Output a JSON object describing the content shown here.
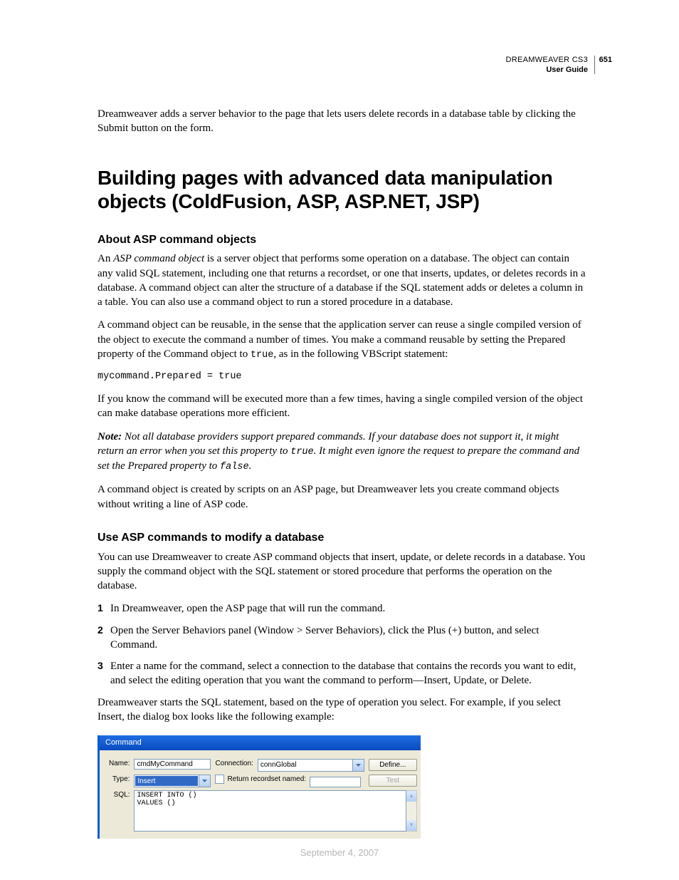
{
  "header": {
    "product": "DREAMWEAVER CS3",
    "guide": "User Guide",
    "page_number": "651"
  },
  "intro_paragraph": "Dreamweaver adds a server behavior to the page that lets users delete records in a database table by clicking the Submit button on the form.",
  "h1": "Building pages with advanced data manipulation objects (ColdFusion, ASP, ASP.NET, JSP)",
  "section1": {
    "heading": "About ASP command objects",
    "p1_lead_in": "An ",
    "p1_em": "ASP command object",
    "p1_rest": " is a server object that performs some operation on a database. The object can contain any valid SQL statement, including one that returns a recordset, or one that inserts, updates, or deletes records in a database. A command object can alter the structure of a database if the SQL statement adds or deletes a column in a table. You can also use a command object to run a stored procedure in a database.",
    "p2_a": "A command object can be reusable, in the sense that the application server can reuse a single compiled version of the object to execute the command a number of times. You make a command reusable by setting the Prepared property of the Command object to ",
    "p2_code": "true",
    "p2_b": ", as in the following VBScript statement:",
    "code_block": "mycommand.Prepared = true",
    "p3": "If you know the command will be executed more than a few times, having a single compiled version of the object can make database operations more efficient.",
    "note_label": "Note:",
    "note_a": " Not all database providers support prepared commands. If your database does not support it, it might return an error when you set this property to ",
    "note_code1": "true",
    "note_b": ". It might even ignore the request to prepare the command and set the Prepared property to ",
    "note_code2": "false",
    "note_c": ".",
    "p4": "A command object is created by scripts on an ASP page, but Dreamweaver lets you create command objects without writing a line of ASP code."
  },
  "section2": {
    "heading": "Use ASP commands to modify a database",
    "p1": "You can use Dreamweaver to create ASP command objects that insert, update, or delete records in a database. You supply the command object with the SQL statement or stored procedure that performs the operation on the database.",
    "steps": [
      "In Dreamweaver, open the ASP page that will run the command.",
      "Open the Server Behaviors panel (Window > Server Behaviors), click the Plus (+) button, and select Command.",
      "Enter a name for the command, select a connection to the database that contains the records you want to edit, and select the editing operation that you want the command to perform—Insert, Update, or Delete."
    ],
    "p2": "Dreamweaver starts the SQL statement, based on the type of operation you select. For example, if you select Insert, the dialog box looks like the following example:"
  },
  "dialog": {
    "title": "Command",
    "labels": {
      "name": "Name:",
      "type": "Type:",
      "connection": "Connection:",
      "return_rs": "Return recordset named:",
      "sql": "SQL:"
    },
    "values": {
      "name": "cmdMyCommand",
      "type": "Insert",
      "connection": "connGlobal",
      "return_rs": "",
      "sql": "INSERT INTO ()\nVALUES ()"
    },
    "buttons": {
      "define": "Define...",
      "test": "Test"
    }
  },
  "footer_date": "September 4, 2007"
}
